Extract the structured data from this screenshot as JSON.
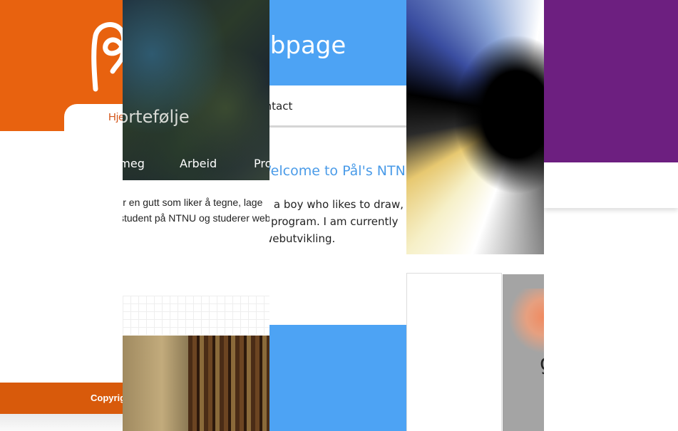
{
  "strip1": {
    "nav_label": "Hjem",
    "footer_text": "Copyright",
    "colors": {
      "header": "#e8620f",
      "footer": "#d85a0b"
    }
  },
  "strip2": {
    "brand": "Portefølje",
    "nav": [
      "Om meg",
      "Arbeid",
      "Prosjekter"
    ],
    "lines": [
      "Jeg er en gutt som liker å tegne, lage",
      "student på NTNU og studerer webutvikling."
    ]
  },
  "strip3": {
    "header_title": "My Webpage",
    "nav_contact": "Contact",
    "welcome": "Welcome to Pål's NTNU",
    "lines": [
      "I'm a boy who likes to draw,",
      "a program. I am currently",
      "webutvikling."
    ],
    "colors": {
      "accent": "#4da3f4"
    }
  },
  "strip4": {
    "glyph": "g"
  },
  "strip5": {
    "colors": {
      "band": "#6d1f80"
    }
  }
}
